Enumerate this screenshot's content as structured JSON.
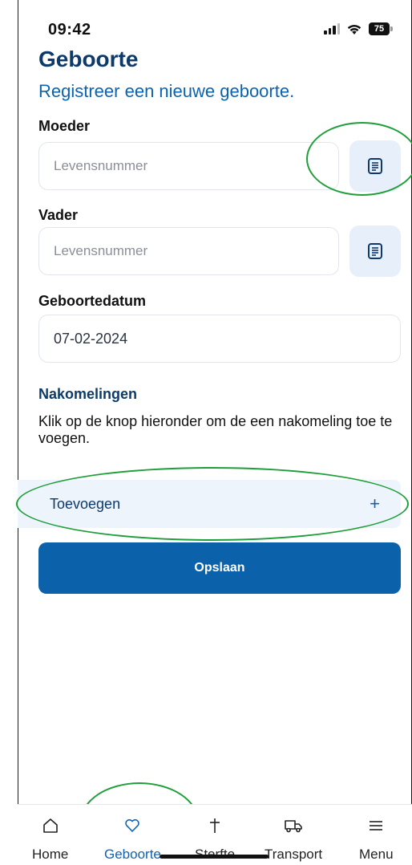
{
  "status_bar": {
    "time": "09:42",
    "battery_level": "75",
    "signal_icon": "cellular-signal-icon",
    "wifi_icon": "wifi-icon",
    "battery_icon": "battery-icon"
  },
  "header": {
    "title": "Geboorte",
    "subtitle": "Registreer een nieuwe geboorte."
  },
  "form": {
    "mother": {
      "label": "Moeder",
      "placeholder": "Levensnummer",
      "value": "",
      "scan_icon": "list-scan-icon"
    },
    "father": {
      "label": "Vader",
      "placeholder": "Levensnummer",
      "value": "",
      "scan_icon": "list-scan-icon"
    },
    "birth_date": {
      "label": "Geboortedatum",
      "value": "07-02-2024"
    },
    "offspring": {
      "title": "Nakomelingen",
      "description": "Klik op de knop hieronder om de een nakomeling toe te voegen.",
      "add_label": "Toevoegen",
      "add_symbol": "+"
    },
    "save_label": "Opslaan"
  },
  "tab_bar": {
    "tabs": [
      {
        "label": "Home",
        "icon": "home-icon",
        "active": false
      },
      {
        "label": "Geboorte",
        "icon": "heart-icon",
        "active": true
      },
      {
        "label": "Sterfte",
        "icon": "cross-icon",
        "active": false
      },
      {
        "label": "Transport",
        "icon": "truck-icon",
        "active": false
      },
      {
        "label": "Menu",
        "icon": "menu-icon",
        "active": false
      }
    ]
  },
  "colors": {
    "primary": "#0b62ab",
    "title": "#0d3a6a",
    "accent_light": "#e7f0fa",
    "annotation": "#1e9e3a"
  }
}
